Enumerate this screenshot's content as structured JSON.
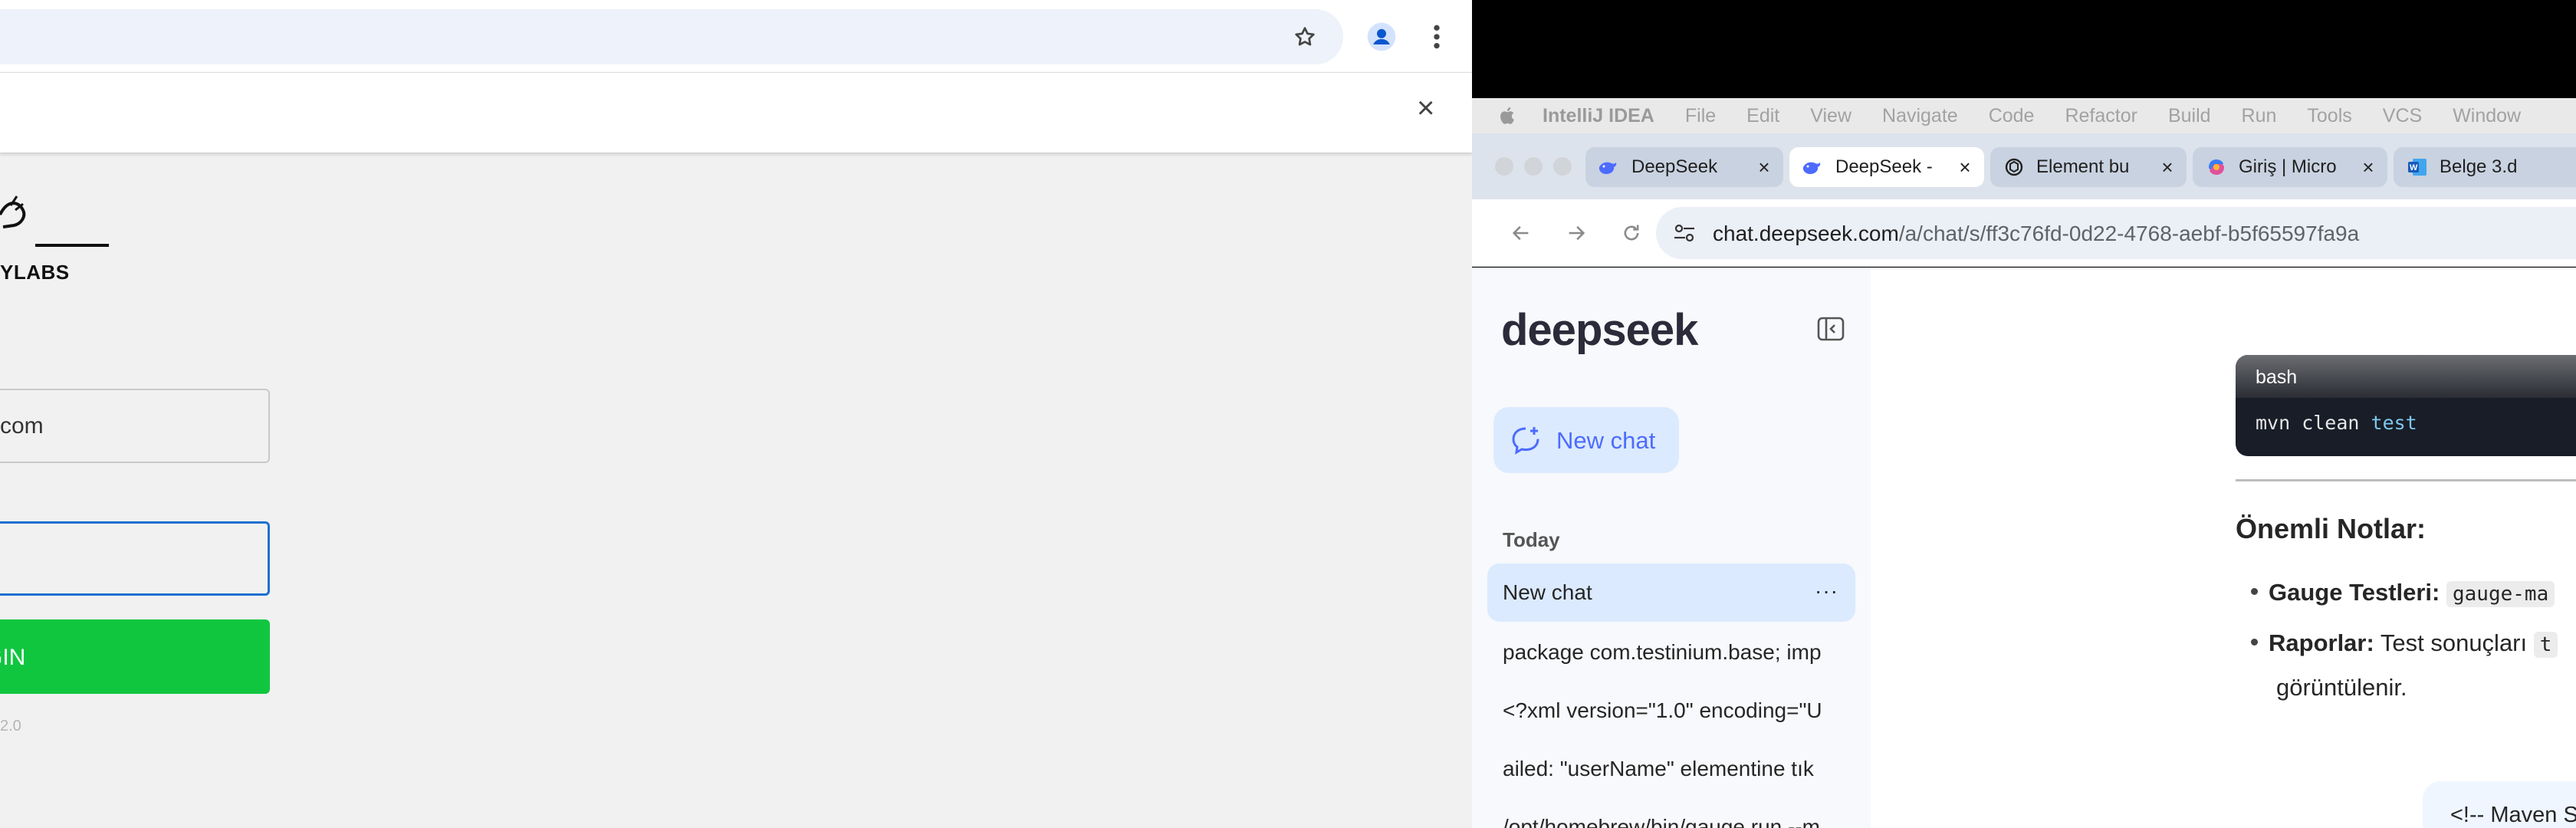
{
  "left": {
    "omnibox_url": "",
    "bookmark_icon": "star-icon",
    "profile_icon": "profile-icon",
    "menu_icon": "kebab-menu-icon",
    "infobar_close": "×",
    "logo_text": "YLABS",
    "email_value": "com",
    "password_value": "",
    "login_label": "GIN",
    "version_text": "2.0",
    "accent": "#10c63f",
    "focus": "#1f6fd1"
  },
  "menubar": {
    "apple_icon": "apple-icon",
    "app_name": "IntelliJ IDEA",
    "items": [
      "File",
      "Edit",
      "View",
      "Navigate",
      "Code",
      "Refactor",
      "Build",
      "Run",
      "Tools",
      "VCS",
      "Window"
    ]
  },
  "tabs": [
    {
      "label": "DeepSeek",
      "icon": "deepseek-whale-icon",
      "active": false
    },
    {
      "label": "DeepSeek -",
      "icon": "deepseek-whale-icon",
      "active": true
    },
    {
      "label": "Element bu",
      "icon": "chatgpt-icon",
      "active": false
    },
    {
      "label": "Giriş | Micro",
      "icon": "copilot-icon",
      "active": false
    },
    {
      "label": "Belge 3.d",
      "icon": "word-icon",
      "active": false
    }
  ],
  "tab_close": "×",
  "address": {
    "host": "chat.deepseek.com",
    "path": "/a/chat/s/ff3c76fd-0d22-4768-aebf-b5f65597fa9a"
  },
  "sidebar": {
    "logo": "deepseek",
    "new_chat": "New chat",
    "section": "Today",
    "active_chat": "New chat",
    "more": "···",
    "history": [
      "package com.testinium.base; imp",
      "<?xml version=\"1.0\" encoding=\"U",
      "ailed: \"userName\" elementine tık",
      "/opt/homebrew/bin/gauge run --m"
    ]
  },
  "chat": {
    "code_lang": "bash",
    "code_cmd": "mvn clean ",
    "code_arg": "test",
    "notes_title": "Önemli Notlar:",
    "bullet1_bold": "Gauge Testleri:",
    "bullet1_code": "gauge-ma",
    "bullet2_bold": "Raporlar:",
    "bullet2_text": " Test sonuçları ",
    "bullet2_code": "t",
    "bullet2_wrap": "görüntülenir.",
    "user_msg": "<!-- Maven S"
  },
  "colors": {
    "deepseek_blue": "#4d6bfe",
    "sidebar_bg": "#f7f9fc",
    "selected_bg": "#dbeafe"
  }
}
